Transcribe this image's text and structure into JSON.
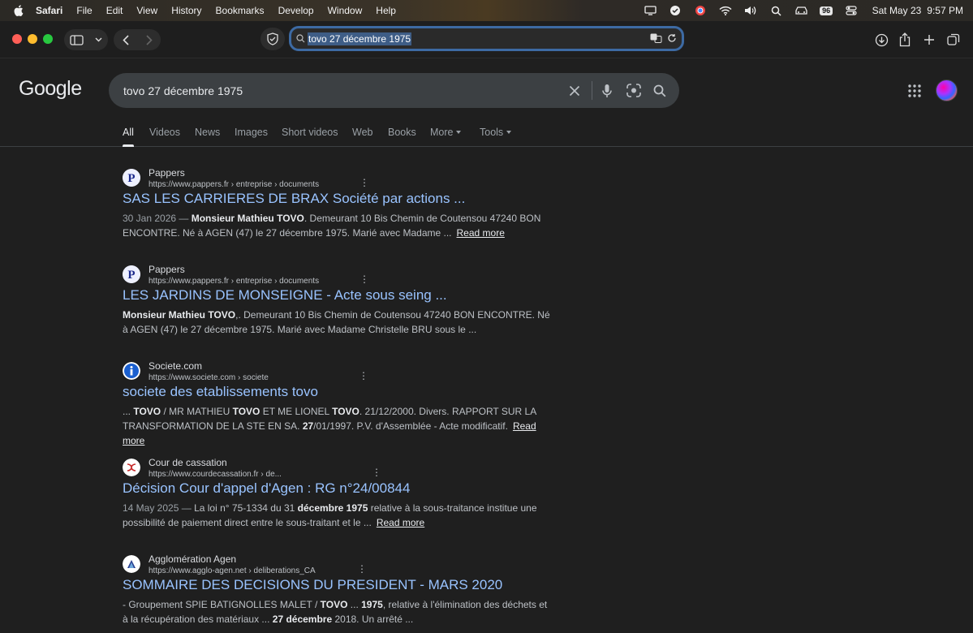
{
  "menubar": {
    "app": "Safari",
    "items": [
      "File",
      "Edit",
      "View",
      "History",
      "Bookmarks",
      "Develop",
      "Window",
      "Help"
    ],
    "battery": "96",
    "date": "Sat May 23",
    "time": "9:57 PM"
  },
  "toolbar": {
    "url": "tovo 27 décembre 1975"
  },
  "google": {
    "logo": "Google",
    "query": "tovo 27 décembre 1975",
    "tabs": [
      "All",
      "Videos",
      "News",
      "Images",
      "Short videos",
      "Web",
      "Books",
      "More",
      "Tools"
    ]
  },
  "results": [
    {
      "site": "Pappers",
      "crumb": "https://www.pappers.fr › entreprise › documents",
      "title": "SAS LES CARRIERES DE BRAX Société par actions ...",
      "date": "30 Jan 2026 — ",
      "s1b": "Monsieur Mathieu TOVO",
      "s2": ". Demeurant 10 Bis Chemin de Coutensou 47240 BON ENCONTRE. Né à AGEN (47) le 27 décembre 1975. Marié avec Madame ...",
      "more": "Read more"
    },
    {
      "site": "Pappers",
      "crumb": "https://www.pappers.fr › entreprise › documents",
      "title": "LES JARDINS DE MONSEIGNE - Acte sous seing ...",
      "s1b": "Monsieur Mathieu TOVO",
      "s2": ",. Demeurant 10 Bis Chemin de Coutensou 47240 BON ENCONTRE. Né à AGEN (47) le 27 décembre 1975. Marié avec Madame Christelle BRU sous le ..."
    },
    {
      "site": "Societe.com",
      "crumb": "https://www.societe.com › societe",
      "title": "societe des etablissements tovo",
      "p1": "... ",
      "b1": "TOVO",
      "p2": " / MR MATHIEU ",
      "b2": "TOVO",
      "p3": " ET ME LIONEL ",
      "b3": "TOVO",
      "p4": ". 21/12/2000. Divers. RAPPORT SUR LA TRANSFORMATION DE LA STE EN SA. ",
      "b4": "27",
      "p5": "/01/1997. P.V. d'Assemblée - Acte modificatif.",
      "more": "Read more"
    },
    {
      "site": "Cour de cassation",
      "crumb": "https://www.courdecassation.fr › de...",
      "title": "Décision Cour d'appel d'Agen : RG n°24/00844",
      "date": "14 May 2025 — ",
      "p1": "La loi n° 75-1334 du 31 ",
      "b1": "décembre 1975",
      "p2": " relative à la sous-traitance institue une possibilité de paiement direct entre le sous-traitant et le ...",
      "more": "Read more"
    },
    {
      "site": "Agglomération Agen",
      "crumb": "https://www.agglo-agen.net › deliberations_CA",
      "title": "SOMMAIRE DES DECISIONS DU PRESIDENT - MARS 2020",
      "p1": "- Groupement SPIE BATIGNOLLES MALET / ",
      "b1": "TOVO",
      "p2": " ... ",
      "b2": "1975",
      "p3": ", relative à l'élimination des déchets et à la récupération des matériaux ... ",
      "b3": "27 décembre",
      "p4": " 2018. Un arrêté ..."
    }
  ],
  "colors": {
    "link": "#99c3ff",
    "background": "#1f1f1f",
    "searchbox": "#3c4043"
  }
}
